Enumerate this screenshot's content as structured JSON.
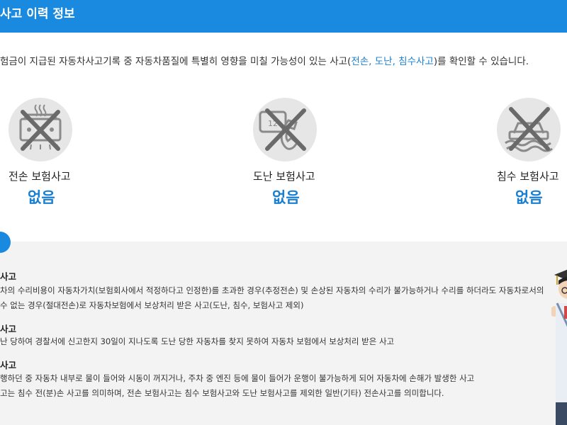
{
  "header": {
    "title": "사고 이력 정보"
  },
  "intro": {
    "before": "험금이 지급된 자동차사고기록 중 자동차품질에 특별히 영향을 미칠 가능성이 있는 사고(",
    "highlight": "전손, 도난, 침수사고",
    "after": ")를 확인할 수 있습니다."
  },
  "cards": [
    {
      "label": "전손 보험사고",
      "value": "없음",
      "icon": "wrecked-car-icon"
    },
    {
      "label": "도난 보험사고",
      "value": "없음",
      "icon": "stolen-car-phone-icon"
    },
    {
      "label": "침수 보험사고",
      "value": "없음",
      "icon": "flooded-car-icon"
    }
  ],
  "definitions": [
    {
      "title": "사고",
      "lines": [
        "차의 수리비용이 자동차가치(보험회사에서 적정하다고 인정한)를 초과한 경우(추정전손) 및 손상된 자동차의 수리가 불가능하거나 수리를 하더라도 자동차로서의",
        " 수 없는 경우(절대전손)로 자동차보험에서 보상처리 받은 사고(도난, 침수, 보험사고 제외)"
      ]
    },
    {
      "title": "사고",
      "lines": [
        "난 당하여 경찰서에 신고한지 30일이 지나도록 도난 당한 자동차를 찾지 못하여 자동차 보험에서 보상처리 받은 사고"
      ]
    },
    {
      "title": "사고",
      "lines": [
        "행하던 중 자동차 내부로 물이 들어와 시동이 꺼지거나, 주차 중 엔진 등에 물이 들어가 운행이 불가능하게 되어 자동차에 손해가 발생한 사고",
        "고는 침수 전(분)손 사고를 의미하며, 전손 보험사고는 침수 보험사고와 도난 보험사고를 제외한 일반(기타) 전손사고를 의미합니다."
      ]
    }
  ],
  "colors": {
    "accent": "#1a8ae0",
    "value": "#1a7fd0",
    "panel": "#f3f3f3"
  }
}
